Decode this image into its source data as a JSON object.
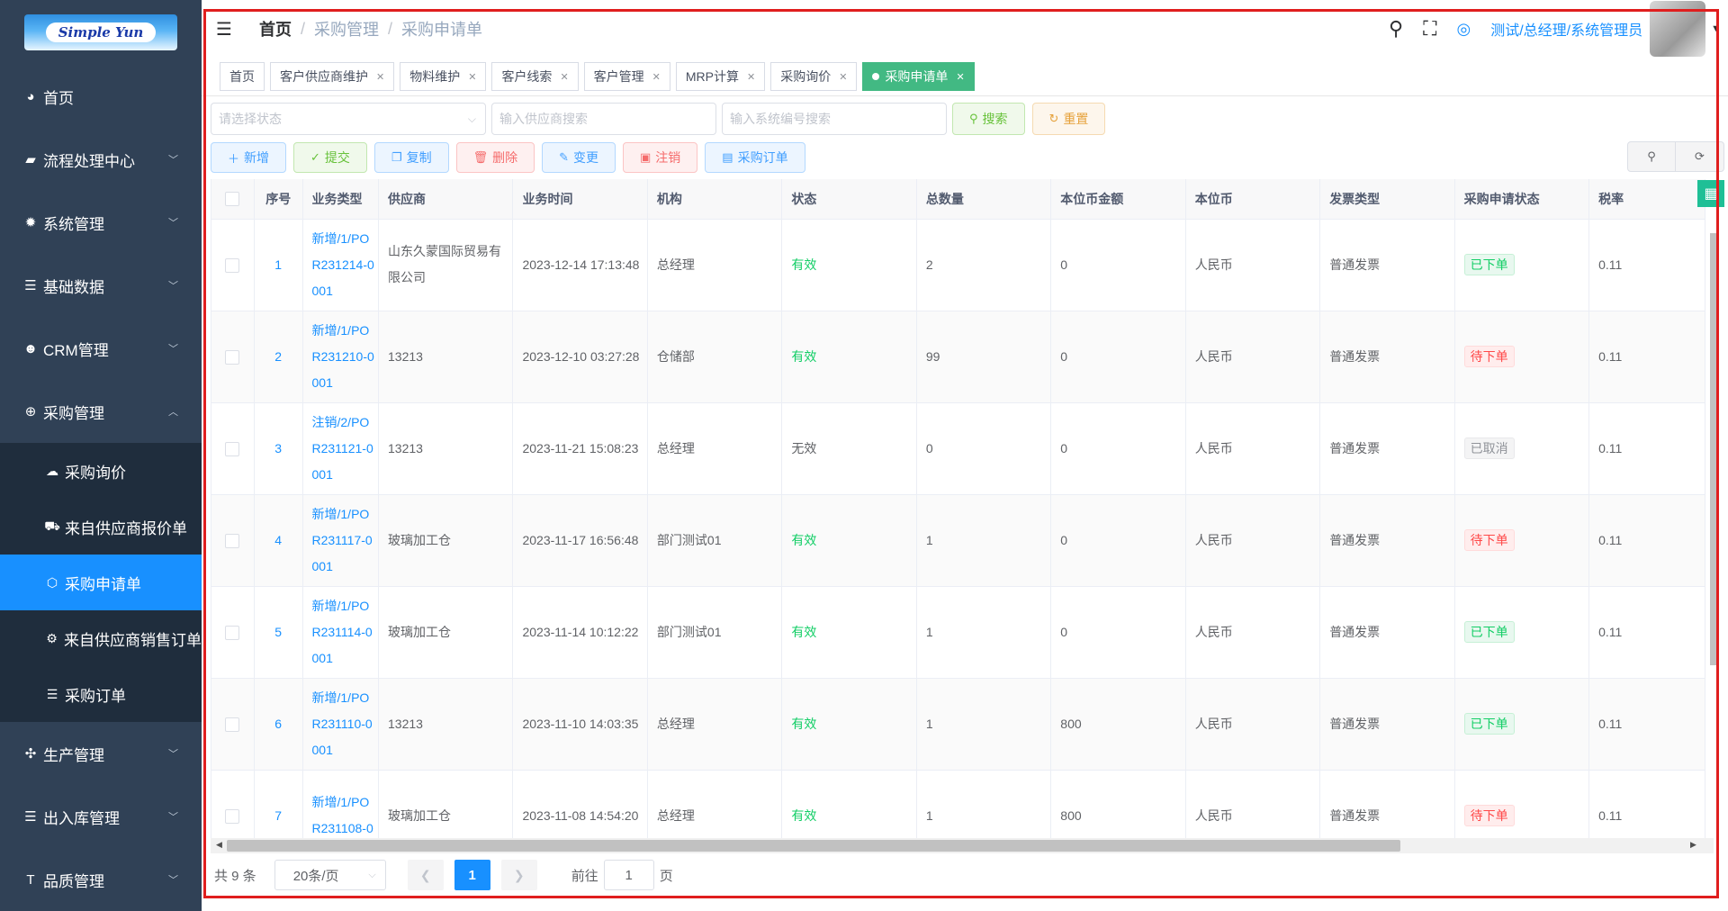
{
  "app": {
    "logo_text": "Simple Yun"
  },
  "sidebar": {
    "items": [
      {
        "label": "首页",
        "icon": "dashboard-icon",
        "glyph": "◕"
      },
      {
        "label": "流程处理中心",
        "icon": "chat-icon",
        "glyph": "▰"
      },
      {
        "label": "系统管理",
        "icon": "gear-icon",
        "glyph": "✹"
      },
      {
        "label": "基础数据",
        "icon": "database-icon",
        "glyph": "☰"
      },
      {
        "label": "CRM管理",
        "icon": "users-icon",
        "glyph": "☻"
      },
      {
        "label": "采购管理",
        "icon": "globe-icon",
        "glyph": "⊕"
      }
    ],
    "sub_items": [
      {
        "label": "采购询价",
        "icon": "wechat-icon",
        "glyph": "☁"
      },
      {
        "label": "来自供应商报价单",
        "icon": "bus-icon",
        "glyph": "⛟"
      },
      {
        "label": "采购申请单",
        "icon": "cube-icon",
        "glyph": "⬡"
      },
      {
        "label": "来自供应商销售订单",
        "icon": "palette-icon",
        "glyph": "⚙"
      },
      {
        "label": "采购订单",
        "icon": "database-icon",
        "glyph": "☰"
      }
    ],
    "items_after": [
      {
        "label": "生产管理",
        "icon": "puzzle-icon",
        "glyph": "✣"
      },
      {
        "label": "出入库管理",
        "icon": "database-icon",
        "glyph": "☰"
      },
      {
        "label": "品质管理",
        "icon": "text-size-icon",
        "glyph": "T"
      }
    ]
  },
  "navbar": {
    "breadcrumb": [
      "首页",
      "采购管理",
      "采购申请单"
    ],
    "user": "测试/总经理/系统管理员"
  },
  "tags": [
    "首页",
    "客户供应商维护",
    "物料维护",
    "客户线索",
    "客户管理",
    "MRP计算",
    "采购询价",
    "采购申请单"
  ],
  "search": {
    "status_placeholder": "请选择状态",
    "supplier_placeholder": "输入供应商搜索",
    "sysno_placeholder": "输入系统编号搜索",
    "search_label": "搜索",
    "reset_label": "重置"
  },
  "toolbar": {
    "add": "新增",
    "submit": "提交",
    "copy": "复制",
    "delete": "删除",
    "change": "变更",
    "cancel": "注销",
    "order": "采购订单"
  },
  "table": {
    "columns": [
      "序号",
      "业务类型",
      "供应商",
      "业务时间",
      "机构",
      "状态",
      "总数量",
      "本位币金额",
      "本位币",
      "发票类型",
      "采购申请状态",
      "税率"
    ],
    "rows": [
      {
        "no": "1",
        "type": "新增/1/POR231214-0001",
        "supplier": "山东久蒙国际贸易有限公司",
        "time": "2023-12-14 17:13:48",
        "org": "总经理",
        "status": "有效",
        "qty": "2",
        "amount": "0",
        "currency": "人民币",
        "invoice": "普通发票",
        "apply": "已下单",
        "tax": "0.11"
      },
      {
        "no": "2",
        "type": "新增/1/POR231210-0001",
        "supplier": "13213",
        "time": "2023-12-10 03:27:28",
        "org": "仓储部",
        "status": "有效",
        "qty": "99",
        "amount": "0",
        "currency": "人民币",
        "invoice": "普通发票",
        "apply": "待下单",
        "tax": "0.11"
      },
      {
        "no": "3",
        "type": "注销/2/POR231121-0001",
        "supplier": "13213",
        "time": "2023-11-21 15:08:23",
        "org": "总经理",
        "status": "无效",
        "qty": "0",
        "amount": "0",
        "currency": "人民币",
        "invoice": "普通发票",
        "apply": "已取消",
        "tax": "0.11"
      },
      {
        "no": "4",
        "type": "新增/1/POR231117-0001",
        "supplier": "玻璃加工仓",
        "time": "2023-11-17 16:56:48",
        "org": "部门测试01",
        "status": "有效",
        "qty": "1",
        "amount": "0",
        "currency": "人民币",
        "invoice": "普通发票",
        "apply": "待下单",
        "tax": "0.11"
      },
      {
        "no": "5",
        "type": "新增/1/POR231114-0001",
        "supplier": "玻璃加工仓",
        "time": "2023-11-14 10:12:22",
        "org": "部门测试01",
        "status": "有效",
        "qty": "1",
        "amount": "0",
        "currency": "人民币",
        "invoice": "普通发票",
        "apply": "已下单",
        "tax": "0.11"
      },
      {
        "no": "6",
        "type": "新增/1/POR231110-0001",
        "supplier": "13213",
        "time": "2023-11-10 14:03:35",
        "org": "总经理",
        "status": "有效",
        "qty": "1",
        "amount": "800",
        "currency": "人民币",
        "invoice": "普通发票",
        "apply": "已下单",
        "tax": "0.11"
      },
      {
        "no": "7",
        "type": "新增/1/POR231108-0",
        "supplier": "玻璃加工仓",
        "time": "2023-11-08 14:54:20",
        "org": "总经理",
        "status": "有效",
        "qty": "1",
        "amount": "800",
        "currency": "人民币",
        "invoice": "普通发票",
        "apply": "待下单",
        "tax": "0.11"
      }
    ]
  },
  "pagination": {
    "total": "共 9 条",
    "page_size": "20条/页",
    "current": "1",
    "goto_label": "前往",
    "goto_value": "1",
    "page_suffix": "页"
  },
  "colors": {
    "sidebar_bg": "#304156",
    "accent": "#1890ff",
    "active_tag": "#42b983",
    "frame": "#e01e1e"
  }
}
